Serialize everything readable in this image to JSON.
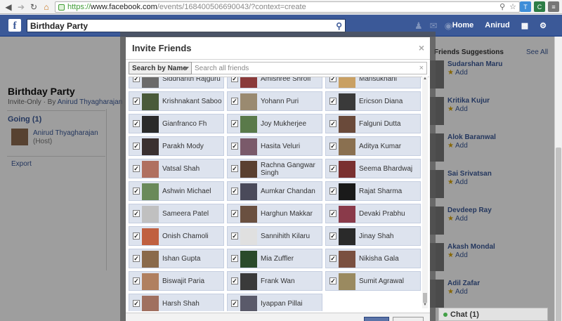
{
  "browser": {
    "url_scheme": "https://",
    "url_host": "www.facebook.com",
    "url_path": "/events/168400506690043/?context=create"
  },
  "fb": {
    "search_value": "Birthday Party",
    "nav_home": "Home",
    "nav_user": "Anirud"
  },
  "event": {
    "title": "Birthday Party",
    "privacy": "Invite-Only",
    "by_prefix": "· By",
    "by_name": "Anirud Thyagharajan",
    "going_label": "Going (1)",
    "host_name": "Anirud Thyagharajan",
    "host_role": "(Host)",
    "export_label": "Export"
  },
  "suggestions": {
    "header": "Friends Suggestions",
    "see_all": "See All",
    "add_label": "Add",
    "items": [
      {
        "name": "Sudarshan Maru"
      },
      {
        "name": "Kritika Kujur"
      },
      {
        "name": "Alok Baranwal"
      },
      {
        "name": "Sai Srivatsan"
      },
      {
        "name": "Devdeep Ray"
      },
      {
        "name": "Akash Mondal"
      },
      {
        "name": "Adil Zafar"
      }
    ]
  },
  "chat": {
    "label": "Chat (1)"
  },
  "dialog": {
    "title": "Invite Friends",
    "close": "×",
    "filter_select": "Search by Name",
    "search_placeholder": "Search all friends",
    "friends": [
      {
        "name": "Siddhanth Rajguru",
        "checked": true,
        "color": "#6b6b6b"
      },
      {
        "name": "Amishree Shroff",
        "checked": true,
        "color": "#8a3a3a"
      },
      {
        "name": "Mansukhani",
        "checked": true,
        "color": "#c9a063"
      },
      {
        "name": "Krishnakant Saboo",
        "checked": true,
        "color": "#4a5a3a"
      },
      {
        "name": "Yohann Puri",
        "checked": true,
        "color": "#9a8a70"
      },
      {
        "name": "Ericson Diana",
        "checked": true,
        "color": "#3a3a3a"
      },
      {
        "name": "Gianfranco Fh",
        "checked": true,
        "color": "#2a2a2a"
      },
      {
        "name": "Joy Mukherjee",
        "checked": true,
        "color": "#5a7a4a"
      },
      {
        "name": "Falguni Dutta",
        "checked": true,
        "color": "#6a4a3a"
      },
      {
        "name": "Parakh Mody",
        "checked": true,
        "color": "#3a3030"
      },
      {
        "name": "Hasita Veluri",
        "checked": true,
        "color": "#7a5a6a"
      },
      {
        "name": "Aditya Kumar",
        "checked": true,
        "color": "#8a7050"
      },
      {
        "name": "Vatsal Shah",
        "checked": true,
        "color": "#b07060"
      },
      {
        "name": "Rachna Gangwar Singh",
        "checked": true,
        "color": "#5a4030"
      },
      {
        "name": "Seema Bhardwaj",
        "checked": true,
        "color": "#7a3030"
      },
      {
        "name": "Ashwin Michael",
        "checked": true,
        "color": "#6a8a5a"
      },
      {
        "name": "Aumkar Chandan",
        "checked": true,
        "color": "#4a4a5a"
      },
      {
        "name": "Rajat Sharma",
        "checked": true,
        "color": "#1a1a1a"
      },
      {
        "name": "Sameera Patel",
        "checked": true,
        "color": "#c0c0c0"
      },
      {
        "name": "Harghun Makkar",
        "checked": true,
        "color": "#6a5040"
      },
      {
        "name": "Devaki Prabhu",
        "checked": true,
        "color": "#8a3a4a"
      },
      {
        "name": "Onish Chamoli",
        "checked": true,
        "color": "#c06040"
      },
      {
        "name": "Sannihith Kilaru",
        "checked": true,
        "color": "#e0e0e0"
      },
      {
        "name": "Jinay Shah",
        "checked": true,
        "color": "#2a2a2a"
      },
      {
        "name": "Ishan Gupta",
        "checked": true,
        "color": "#8a6a4a"
      },
      {
        "name": "Mia Zuffler",
        "checked": true,
        "color": "#2a4a2a"
      },
      {
        "name": "Nikisha Gala",
        "checked": true,
        "color": "#7a5040"
      },
      {
        "name": "Biswajit Paria",
        "checked": true,
        "color": "#b08060"
      },
      {
        "name": "Frank Wan",
        "checked": true,
        "color": "#3a3a3a"
      },
      {
        "name": "Sumit Agrawal",
        "checked": true,
        "color": "#9a8a60"
      },
      {
        "name": "Harsh Shah",
        "checked": true,
        "color": "#a07060"
      },
      {
        "name": "Iyappan Pillai",
        "checked": true,
        "color": "#5a5a6a"
      }
    ]
  }
}
